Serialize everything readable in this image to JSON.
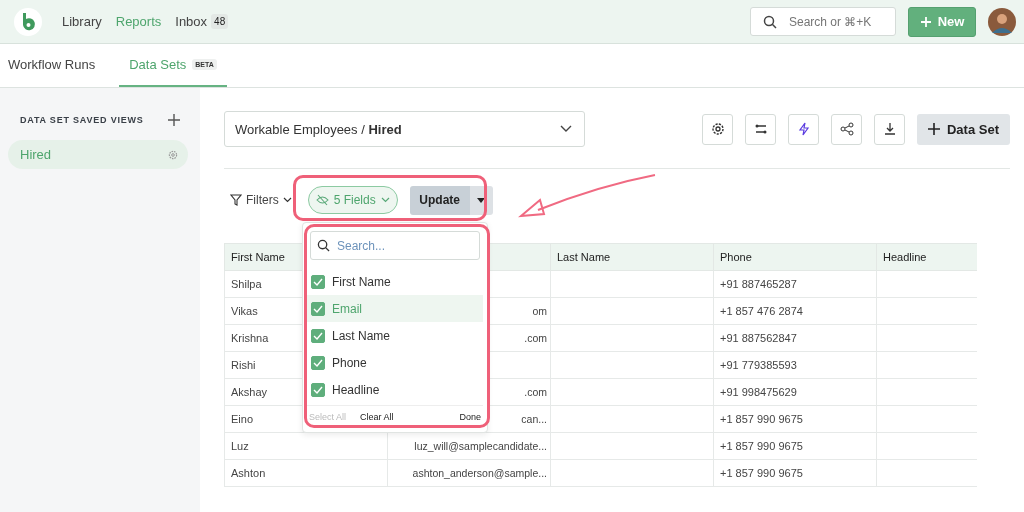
{
  "nav": {
    "items": [
      {
        "label": "Library",
        "selected": false
      },
      {
        "label": "Reports",
        "selected": true
      },
      {
        "label": "Inbox",
        "selected": false,
        "badge": "48"
      }
    ],
    "search": {
      "placeholder": "Search or ⌘+K"
    },
    "new_button": "New"
  },
  "tabs": [
    {
      "label": "Workflow Runs",
      "selected": false
    },
    {
      "label": "Data Sets",
      "selected": true,
      "badge": "BETA"
    }
  ],
  "sidebar": {
    "heading": "DATA SET SAVED VIEWS",
    "items": [
      {
        "label": "Hired",
        "selected": true
      }
    ]
  },
  "dataset_select": {
    "prefix": "Workable Employees / ",
    "value": "Hired"
  },
  "add_button": "Data Set",
  "toolbar": {
    "filters": "Filters",
    "fields": "5 Fields",
    "update": "Update"
  },
  "fields_menu": {
    "placeholder": "Search...",
    "items": [
      {
        "label": "First Name",
        "checked": true,
        "selected": false
      },
      {
        "label": "Email",
        "checked": true,
        "selected": true
      },
      {
        "label": "Last Name",
        "checked": true,
        "selected": false
      },
      {
        "label": "Phone",
        "checked": true,
        "selected": false
      },
      {
        "label": "Headline",
        "checked": true,
        "selected": false
      }
    ],
    "select_all": {
      "label": "Select All",
      "disabled": true
    },
    "clear_all": "Clear All",
    "done": "Done"
  },
  "table": {
    "columns": [
      "First Name",
      "",
      "Last Name",
      "Phone",
      "Headline"
    ],
    "rows": [
      [
        "Shilpa",
        "",
        "",
        "+91 887465287",
        ""
      ],
      [
        "Vikas",
        "om",
        "",
        "+1 857 476 2874",
        ""
      ],
      [
        "Krishna",
        ".com",
        "",
        "+91 887562847",
        ""
      ],
      [
        "Rishi",
        "",
        "",
        "+91 779385593",
        ""
      ],
      [
        "Akshay",
        ".com",
        "",
        "+91 998475629",
        ""
      ],
      [
        "Eino",
        "can...",
        "",
        "+1 857 990 9675",
        ""
      ],
      [
        "Luz",
        "luz_will@samplecandidate...",
        "",
        "+1 857 990 9675",
        ""
      ],
      [
        "Ashton",
        "ashton_anderson@sample...",
        "",
        "+1 857 990 9675",
        ""
      ]
    ]
  }
}
